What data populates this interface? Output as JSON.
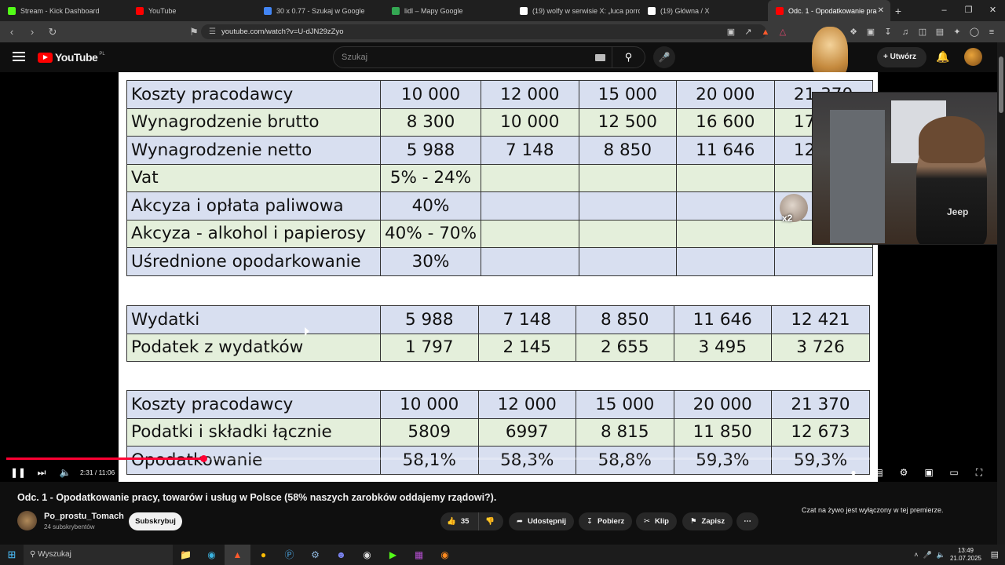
{
  "browser": {
    "tabs": [
      {
        "label": "Stream - Kick Dashboard",
        "color": "#53fc18"
      },
      {
        "label": "YouTube",
        "color": "#ff0000"
      },
      {
        "label": "30 x 0.77 - Szukaj w Google",
        "color": "#4285f4"
      },
      {
        "label": "lidl – Mapy Google",
        "color": "#34a853"
      },
      {
        "label": "(19) wolfy w serwisie X: „luca porro l",
        "color": "#ffffff"
      },
      {
        "label": "(19) Główna / X",
        "color": "#ffffff"
      },
      {
        "label": "Odc. 1 - Opodatkowanie pra",
        "color": "#ff0000"
      }
    ],
    "url": "youtube.com/watch?v=U-dJN29zZyo"
  },
  "youtube": {
    "logo_text": "YouTube",
    "logo_region": "PL",
    "search_placeholder": "Szukaj",
    "create_label": "Utwórz"
  },
  "slide": {
    "table1": [
      {
        "label": "Koszty pracodawcy",
        "values": [
          "10 000",
          "12 000",
          "15 000",
          "20 000",
          "21 370"
        ],
        "color": "blue"
      },
      {
        "label": "Wynagrodzenie brutto",
        "values": [
          "8 300",
          "10 000",
          "12 500",
          "16 600",
          "17 737"
        ],
        "color": "green"
      },
      {
        "label": "Wynagrodzenie netto",
        "values": [
          "5 988",
          "7 148",
          "8 850",
          "11 646",
          "12 421"
        ],
        "color": "blue"
      },
      {
        "label": "Vat",
        "values": [
          "5% - 24%",
          "",
          "",
          "",
          ""
        ],
        "color": "green"
      },
      {
        "label": "Akcyza i opłata paliwowa",
        "values": [
          "40%",
          "",
          "",
          "",
          ""
        ],
        "color": "blue"
      },
      {
        "label": "Akcyza - alkohol i papierosy",
        "values": [
          "40% - 70%",
          "",
          "",
          "",
          ""
        ],
        "color": "green"
      },
      {
        "label": "Uśrednione opodarkowanie",
        "values": [
          "30%",
          "",
          "",
          "",
          ""
        ],
        "color": "blue"
      }
    ],
    "table2": [
      {
        "label": "Wydatki",
        "values": [
          "5 988",
          "7 148",
          "8 850",
          "11 646",
          "12 421"
        ],
        "color": "blue"
      },
      {
        "label": "Podatek z wydatków",
        "values": [
          "1 797",
          "2 145",
          "2 655",
          "3 495",
          "3 726"
        ],
        "color": "green"
      }
    ],
    "table3": [
      {
        "label": "Koszty pracodawcy",
        "values": [
          "10 000",
          "12 000",
          "15 000",
          "20 000",
          "21 370"
        ],
        "color": "blue"
      },
      {
        "label": "Podatki i składki łącznie",
        "values": [
          "5809",
          "6997",
          "8 815",
          "11 850",
          "12 673"
        ],
        "color": "green"
      },
      {
        "label": "Opodatkowanie",
        "values": [
          "58,1%",
          "58,3%",
          "58,8%",
          "59,3%",
          "59,3%"
        ],
        "color": "blue"
      }
    ],
    "sticker_text": "x2",
    "webcam_shirt_text": "Jeep"
  },
  "player": {
    "time": "2:31 / 11:06",
    "progress": 0.227
  },
  "video": {
    "title": "Odc. 1 - Opodatkowanie pracy, towarów i usług w Polsce (58% naszych zarobków oddajemy rządowi?).",
    "channel": "Po_prostu_Tomach",
    "subscribers": "24 subskrybentów",
    "subscribe_label": "Subskrybuj",
    "likes": "35",
    "share_label": "Udostępnij",
    "download_label": "Pobierz",
    "clip_label": "Klip",
    "save_label": "Zapisz",
    "chat_notice": "Czat na żywo jest wyłączony w tej premierze."
  },
  "taskbar": {
    "search_label": "Wyszukaj",
    "time": "13:49",
    "date": "21.07.2025"
  }
}
